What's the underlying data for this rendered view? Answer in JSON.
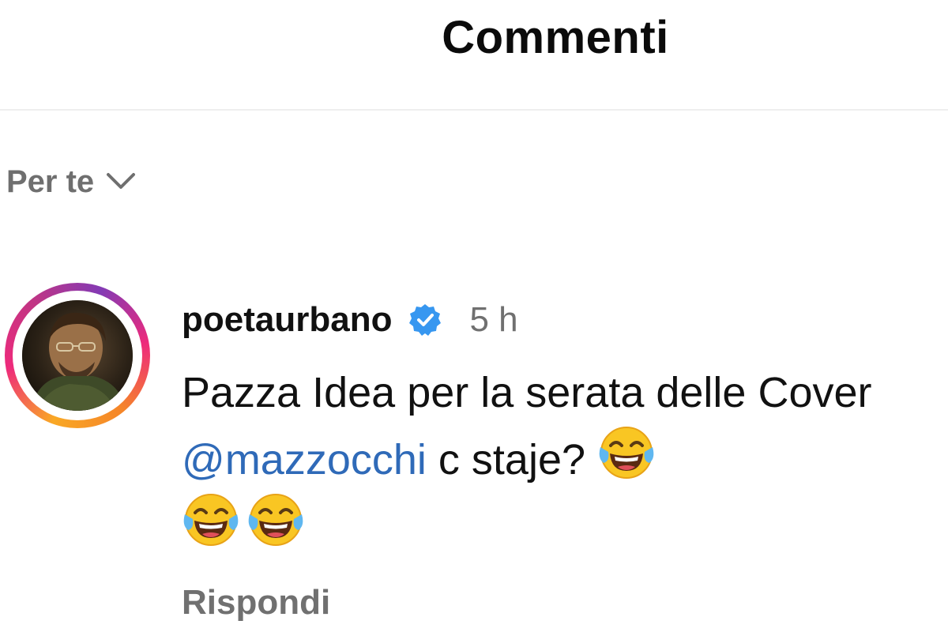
{
  "header": {
    "title": "Commenti"
  },
  "filter": {
    "label": "Per te",
    "icon": "chevron-down-icon"
  },
  "comment": {
    "username": "poetaurbano",
    "verified": true,
    "time": "5 h",
    "text_part1": "Pazza Idea per la serata delle Cover ",
    "mention": "@mazzocchi",
    "text_part2": " c staje? ",
    "emoji_name": "face-with-tears-of-joy",
    "reply_label": "Rispondi"
  },
  "colors": {
    "mention": "#2f6ab8",
    "verified_badge": "#3797f0",
    "secondary_text": "#707070"
  }
}
